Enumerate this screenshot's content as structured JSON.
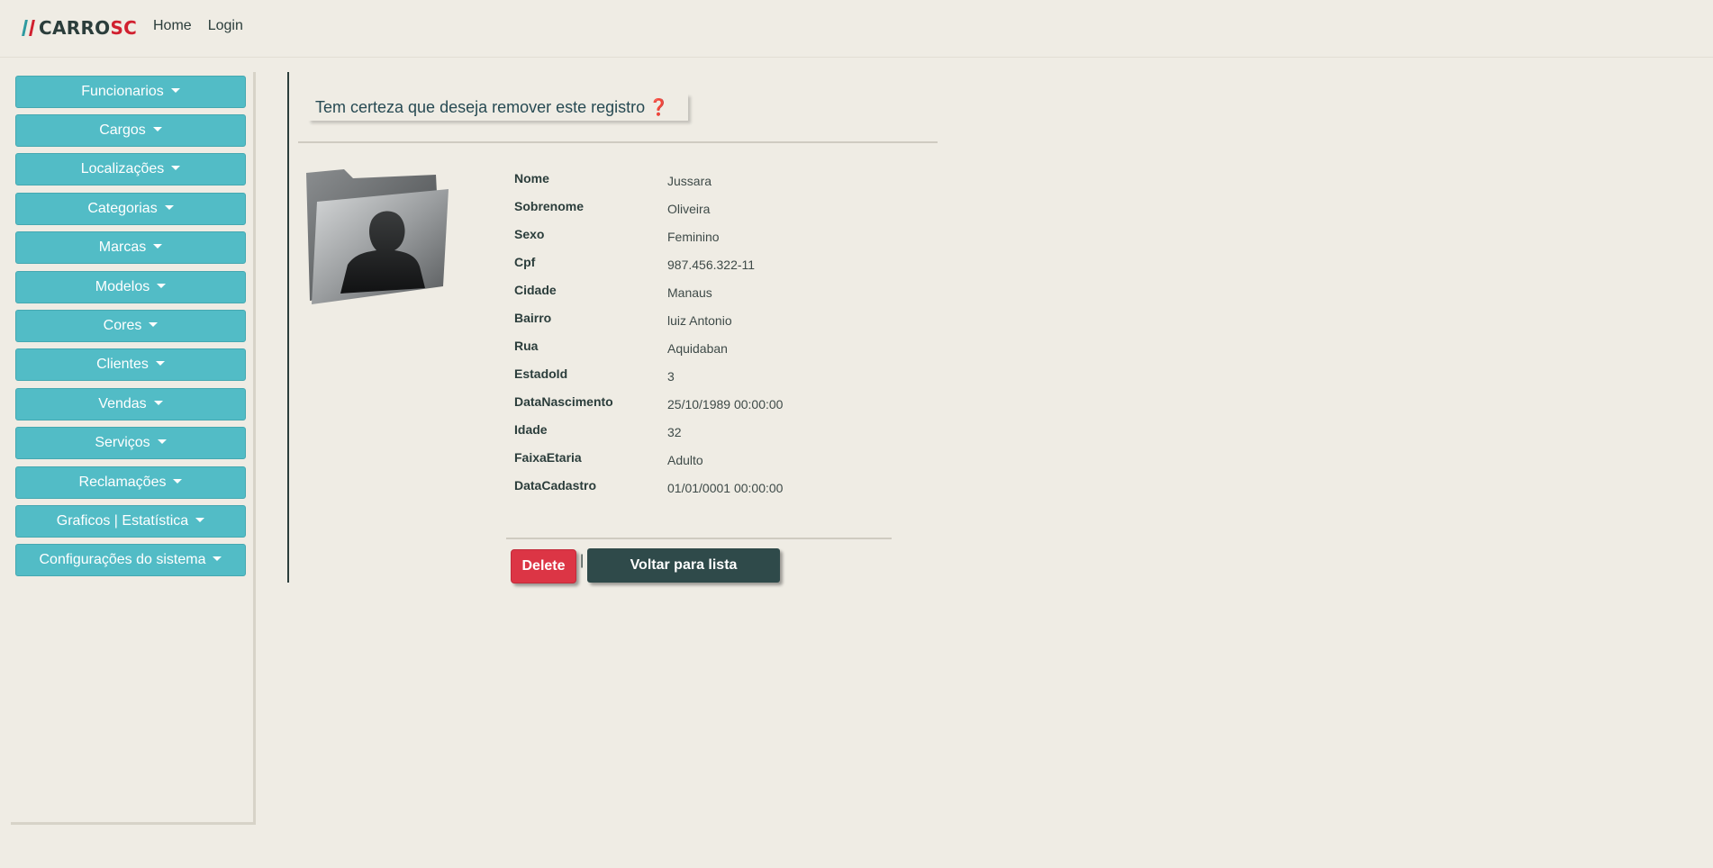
{
  "brand": {
    "carro": "CARRO",
    "sc": "SC"
  },
  "nav": {
    "home": "Home",
    "login": "Login"
  },
  "sidebar": {
    "items": [
      {
        "label": "Funcionarios"
      },
      {
        "label": "Cargos"
      },
      {
        "label": "Localizações"
      },
      {
        "label": "Categorias"
      },
      {
        "label": "Marcas"
      },
      {
        "label": "Modelos"
      },
      {
        "label": "Cores"
      },
      {
        "label": "Clientes"
      },
      {
        "label": "Vendas"
      },
      {
        "label": "Serviços"
      },
      {
        "label": "Reclamações"
      },
      {
        "label": "Graficos | Estatística"
      },
      {
        "label": "Configurações do sistema"
      }
    ]
  },
  "main": {
    "question": "Tem certeza que deseja remover este registro",
    "question_mark": "❓",
    "separator": "|",
    "details": [
      {
        "label": "Nome",
        "value": "Jussara"
      },
      {
        "label": "Sobrenome",
        "value": "Oliveira"
      },
      {
        "label": "Sexo",
        "value": "Feminino"
      },
      {
        "label": "Cpf",
        "value": "987.456.322-11"
      },
      {
        "label": "Cidade",
        "value": "Manaus"
      },
      {
        "label": "Bairro",
        "value": "luiz Antonio"
      },
      {
        "label": "Rua",
        "value": "Aquidaban"
      },
      {
        "label": "EstadoId",
        "value": "3"
      },
      {
        "label": "DataNascimento",
        "value": "25/10/1989 00:00:00"
      },
      {
        "label": "Idade",
        "value": "32"
      },
      {
        "label": "FaixaEtaria",
        "value": "Adulto"
      },
      {
        "label": "DataCadastro",
        "value": "01/01/0001 00:00:00"
      }
    ],
    "delete_label": "Delete",
    "back_label": "Voltar para lista"
  },
  "colors": {
    "background": "#efece4",
    "sidebar_button": "#52bcc6",
    "delete": "#dc3545",
    "back": "#2f4a4a",
    "brand_red": "#d1202f",
    "brand_teal": "#2e9aa0"
  }
}
